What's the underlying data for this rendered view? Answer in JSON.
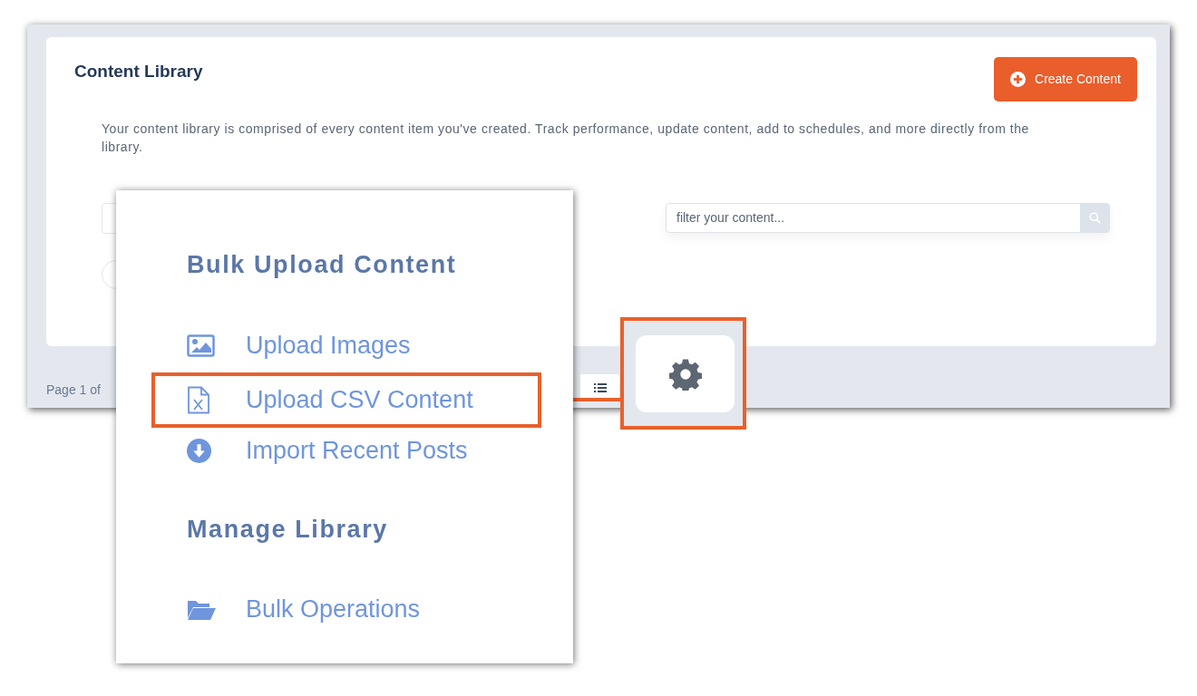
{
  "page": {
    "title": "Content Library",
    "create_button": "Create Content",
    "description": "Your content library is comprised of every content item you've created. Track performance, update content, add to schedules, and more directly from the library.",
    "filter": {
      "placeholder": "filter your content..."
    },
    "pagination": "Page 1 of"
  },
  "menu": {
    "sections": [
      {
        "heading": "Bulk Upload Content",
        "items": [
          {
            "label": "Upload Images",
            "kind": "image",
            "highlighted": false
          },
          {
            "label": "Upload CSV Content",
            "kind": "csv",
            "highlighted": true
          },
          {
            "label": "Import Recent Posts",
            "kind": "import",
            "highlighted": false
          }
        ]
      },
      {
        "heading": "Manage Library",
        "items": [
          {
            "label": "Bulk Operations",
            "kind": "folder",
            "highlighted": false
          }
        ]
      }
    ]
  }
}
